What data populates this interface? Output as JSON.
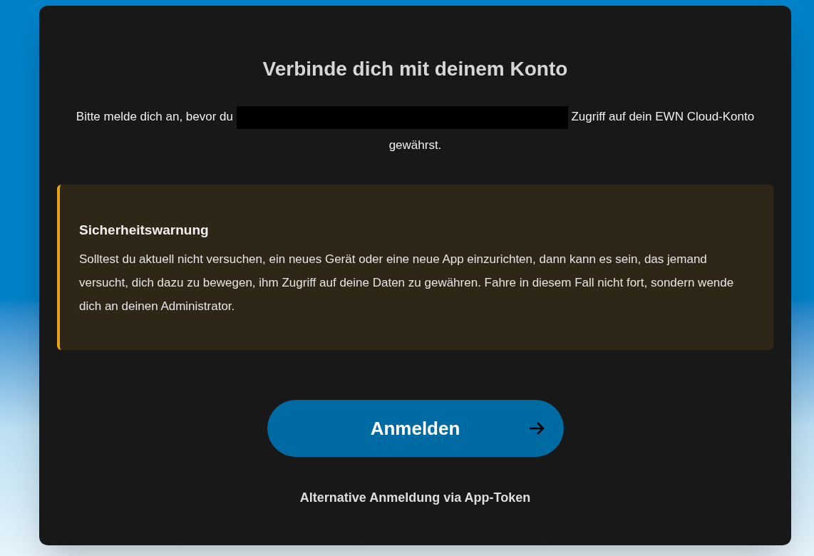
{
  "dialog": {
    "title": "Verbinde dich mit deinem Konto",
    "intro": {
      "before": "Bitte melde dich an, bevor du",
      "redacted": true,
      "after": "Zugriff auf dein EWN Cloud-Konto gewährst."
    },
    "warning": {
      "title": "Sicherheitswarnung",
      "text": "Solltest du aktuell nicht versuchen, ein neues Gerät oder eine neue App einzurichten, dann kann es sein, das jemand versucht, dich dazu zu bewegen, ihm Zugriff auf deine Daten zu gewähren. Fahre in diesem Fall nicht fort, sondern wende dich an deinen Administrator."
    },
    "login_button": {
      "label": "Anmelden"
    },
    "alternative_link": "Alternative Anmeldung via App-Token"
  }
}
